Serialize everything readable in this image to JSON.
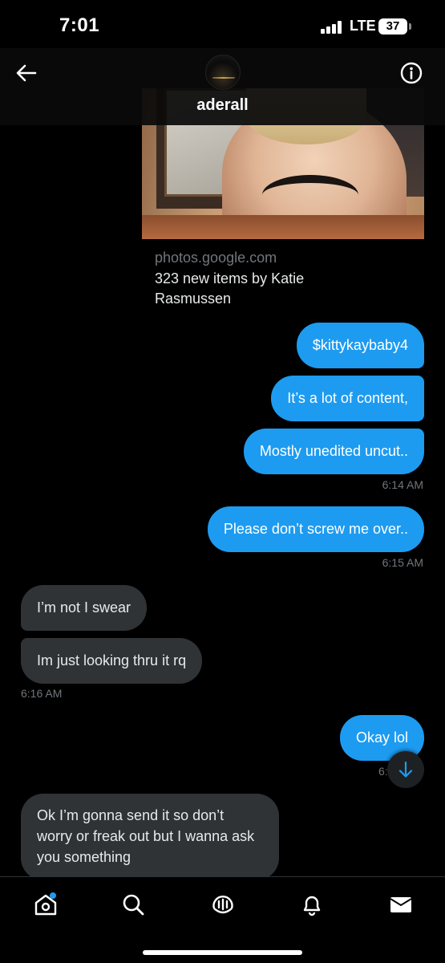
{
  "status_bar": {
    "time": "7:01",
    "network": "LTE",
    "battery": "37"
  },
  "header": {
    "contact_name": "aderall",
    "back_icon": "back-arrow-icon",
    "info_icon": "info-icon"
  },
  "shared_link": {
    "domain": "photos.google.com",
    "title": "323 new items by Katie Rasmussen"
  },
  "messages": [
    {
      "direction": "outgoing",
      "text": "$kittykaybaby4"
    },
    {
      "direction": "outgoing",
      "text": "It’s a lot of content,"
    },
    {
      "direction": "outgoing",
      "text": "Mostly unedited uncut.."
    },
    {
      "direction": "outgoing",
      "text": "Please don’t screw me over.."
    },
    {
      "direction": "incoming",
      "text": "I’m not I swear"
    },
    {
      "direction": "incoming",
      "text": "Im just looking thru it rq"
    },
    {
      "direction": "outgoing",
      "text": "Okay lol"
    },
    {
      "direction": "incoming",
      "text": "Ok I’m gonna send it so don’t worry or freak out but I wanna ask you something"
    }
  ],
  "timestamps": [
    "6:14 AM",
    "6:15 AM",
    "6:16 AM",
    "6:"
  ],
  "bottom_nav": {
    "items": [
      "home-icon",
      "search-icon",
      "grok-icon",
      "notifications-icon",
      "messages-icon"
    ],
    "home_has_unread_dot": true
  },
  "colors": {
    "background": "#000000",
    "outgoing_bubble": "#1d9bf0",
    "incoming_bubble": "#2f3336",
    "secondary_text": "#71767b"
  }
}
